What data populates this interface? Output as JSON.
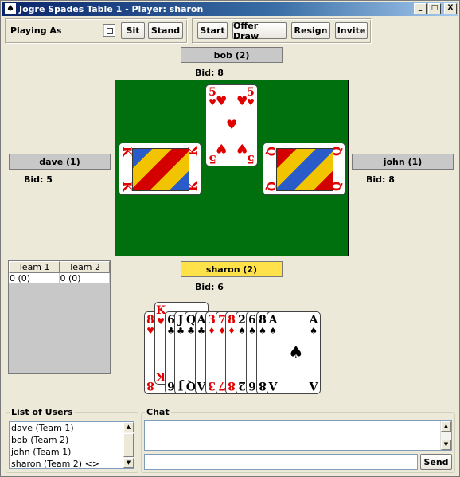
{
  "window": {
    "title": "Jogre Spades Table 1 - Player: sharon",
    "controls": {
      "minimize": "_",
      "maximize": "□",
      "close": "X"
    }
  },
  "toolbar": {
    "playing_as_label": "Playing As",
    "sit": "Sit",
    "stand": "Stand",
    "start": "Start",
    "offer_draw": "Offer Draw",
    "resign": "Resign",
    "invite": "Invite"
  },
  "players": {
    "north": {
      "name": "bob (2)",
      "bid": "Bid: 8"
    },
    "west": {
      "name": "dave (1)",
      "bid": "Bid: 5"
    },
    "east": {
      "name": "john (1)",
      "bid": "Bid: 8"
    },
    "south": {
      "name": "sharon (2)",
      "bid": "Bid: 6",
      "active": true
    }
  },
  "trick": {
    "north": {
      "rank": "5",
      "suit": "♥",
      "color": "red"
    },
    "west": {
      "rank": "K",
      "suit": "♥",
      "color": "red"
    },
    "east": {
      "rank": "Q",
      "suit": "♥",
      "color": "red"
    }
  },
  "hand": [
    {
      "rank": "8",
      "suit": "♥",
      "color": "red"
    },
    {
      "rank": "K",
      "suit": "♥",
      "color": "red",
      "selected": true
    },
    {
      "rank": "6",
      "suit": "♣",
      "color": "black"
    },
    {
      "rank": "J",
      "suit": "♣",
      "color": "black"
    },
    {
      "rank": "Q",
      "suit": "♣",
      "color": "black"
    },
    {
      "rank": "A",
      "suit": "♣",
      "color": "black"
    },
    {
      "rank": "3",
      "suit": "♦",
      "color": "red"
    },
    {
      "rank": "7",
      "suit": "♦",
      "color": "red"
    },
    {
      "rank": "8",
      "suit": "♦",
      "color": "red"
    },
    {
      "rank": "2",
      "suit": "♠",
      "color": "black"
    },
    {
      "rank": "6",
      "suit": "♠",
      "color": "black"
    },
    {
      "rank": "8",
      "suit": "♠",
      "color": "black"
    },
    {
      "rank": "A",
      "suit": "♠",
      "color": "black"
    }
  ],
  "scores": {
    "columns": [
      "Team 1",
      "Team 2"
    ],
    "rows": [
      [
        "0 (0)",
        "0 (0)"
      ]
    ]
  },
  "users": {
    "title": "List of Users",
    "items": [
      "dave (Team 1)",
      "bob (Team 2)",
      "john (Team 1)",
      "sharon (Team 2) <>"
    ]
  },
  "chat": {
    "title": "Chat",
    "input_value": "",
    "send": "Send"
  }
}
